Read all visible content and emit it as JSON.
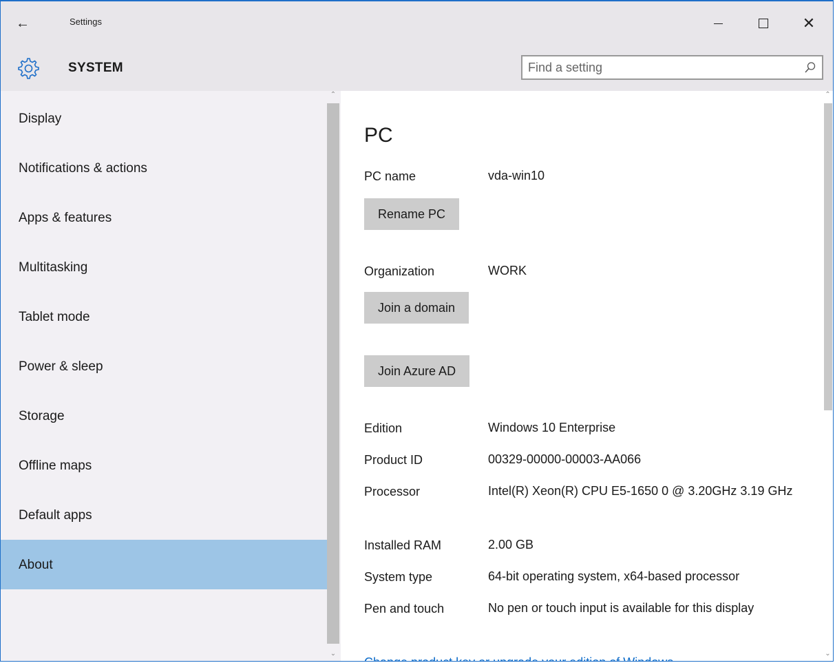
{
  "window": {
    "title": "Settings",
    "back_icon": "back-arrow-icon",
    "controls": [
      "minimize",
      "maximize",
      "close"
    ]
  },
  "header": {
    "section": "SYSTEM",
    "section_icon": "gear-icon",
    "search_placeholder": "Find a setting",
    "search_icon": "search-icon"
  },
  "sidebar": {
    "items": [
      {
        "label": "Display"
      },
      {
        "label": "Notifications & actions"
      },
      {
        "label": "Apps & features"
      },
      {
        "label": "Multitasking"
      },
      {
        "label": "Tablet mode"
      },
      {
        "label": "Power & sleep"
      },
      {
        "label": "Storage"
      },
      {
        "label": "Offline maps"
      },
      {
        "label": "Default apps"
      },
      {
        "label": "About",
        "active": true
      }
    ],
    "active_color": "#9dc5e6"
  },
  "main": {
    "title": "PC",
    "pc_name": {
      "label": "PC name",
      "value": "vda-win10"
    },
    "rename_button": "Rename PC",
    "organization": {
      "label": "Organization",
      "value": "WORK"
    },
    "join_domain_button": "Join a domain",
    "join_azure_button": "Join Azure AD",
    "specs": [
      {
        "label": "Edition",
        "value": "Windows 10 Enterprise"
      },
      {
        "label": "Product ID",
        "value": "00329-00000-00003-AA066"
      },
      {
        "label": "Processor",
        "value": "Intel(R) Xeon(R) CPU E5-1650 0 @ 3.20GHz 3.19 GHz"
      },
      {
        "label": "Installed RAM",
        "value": "2.00 GB"
      },
      {
        "label": "System type",
        "value": "64-bit operating system, x64-based processor"
      },
      {
        "label": "Pen and touch",
        "value": "No pen or touch input is available for this display"
      }
    ],
    "upgrade_link": "Change product key or upgrade your edition of Windows",
    "link_color": "#0a6ac9"
  }
}
